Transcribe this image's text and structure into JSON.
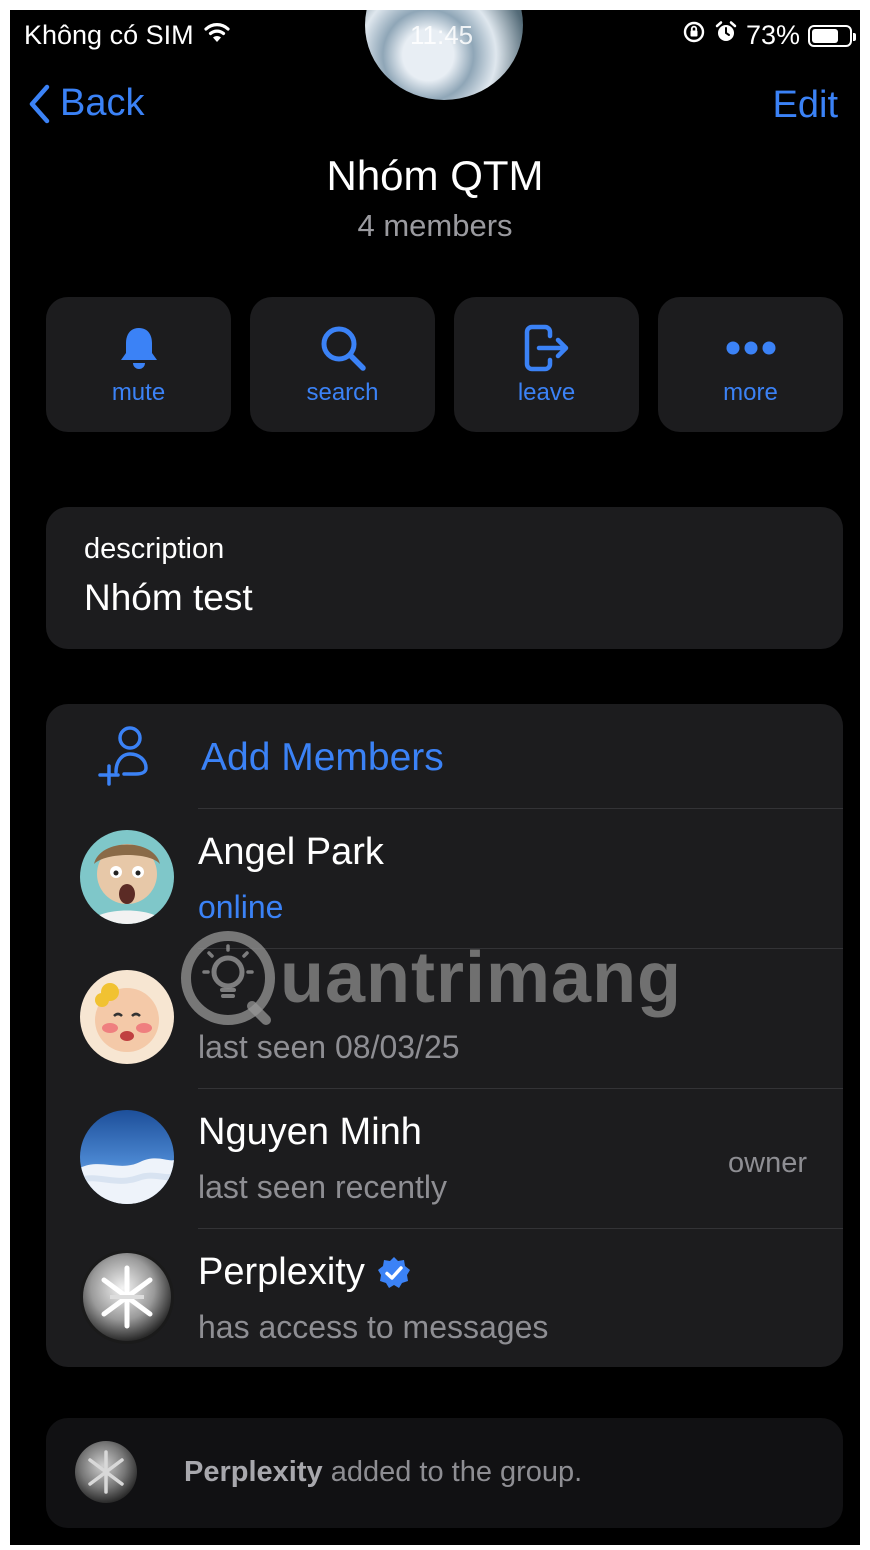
{
  "status_bar": {
    "carrier": "Không có SIM",
    "time": "11:45",
    "battery": "73%",
    "battery_level": 0.73,
    "icons": [
      "wifi-icon",
      "rotation-lock-icon",
      "alarm-icon",
      "battery-icon"
    ]
  },
  "nav": {
    "back_label": "Back",
    "edit_label": "Edit"
  },
  "group": {
    "name": "Nhóm QTM",
    "members_count": "4 members"
  },
  "actions": [
    {
      "label": "mute",
      "icon": "bell-icon"
    },
    {
      "label": "search",
      "icon": "search-icon"
    },
    {
      "label": "leave",
      "icon": "leave-icon"
    },
    {
      "label": "more",
      "icon": "more-icon"
    }
  ],
  "description": {
    "label": "description",
    "value": "Nhóm test"
  },
  "members": {
    "add_label": "Add Members",
    "list": [
      {
        "name": "Angel Park",
        "status": "online",
        "role": ""
      },
      {
        "name": "",
        "status": "last seen 08/03/25",
        "role": ""
      },
      {
        "name": "Nguyen Minh",
        "status": "last seen recently",
        "role": "owner"
      },
      {
        "name": "Perplexity",
        "status": "has access to messages",
        "role": "",
        "verified": true
      }
    ]
  },
  "watermark": {
    "text": "uantrimang"
  },
  "notice": {
    "actor": "Perplexity",
    "text": " added to the group."
  },
  "colors": {
    "accent": "#3b82f6",
    "card": "#1c1c1e",
    "background": "#000000",
    "secondary_text": "#8e8e93"
  }
}
